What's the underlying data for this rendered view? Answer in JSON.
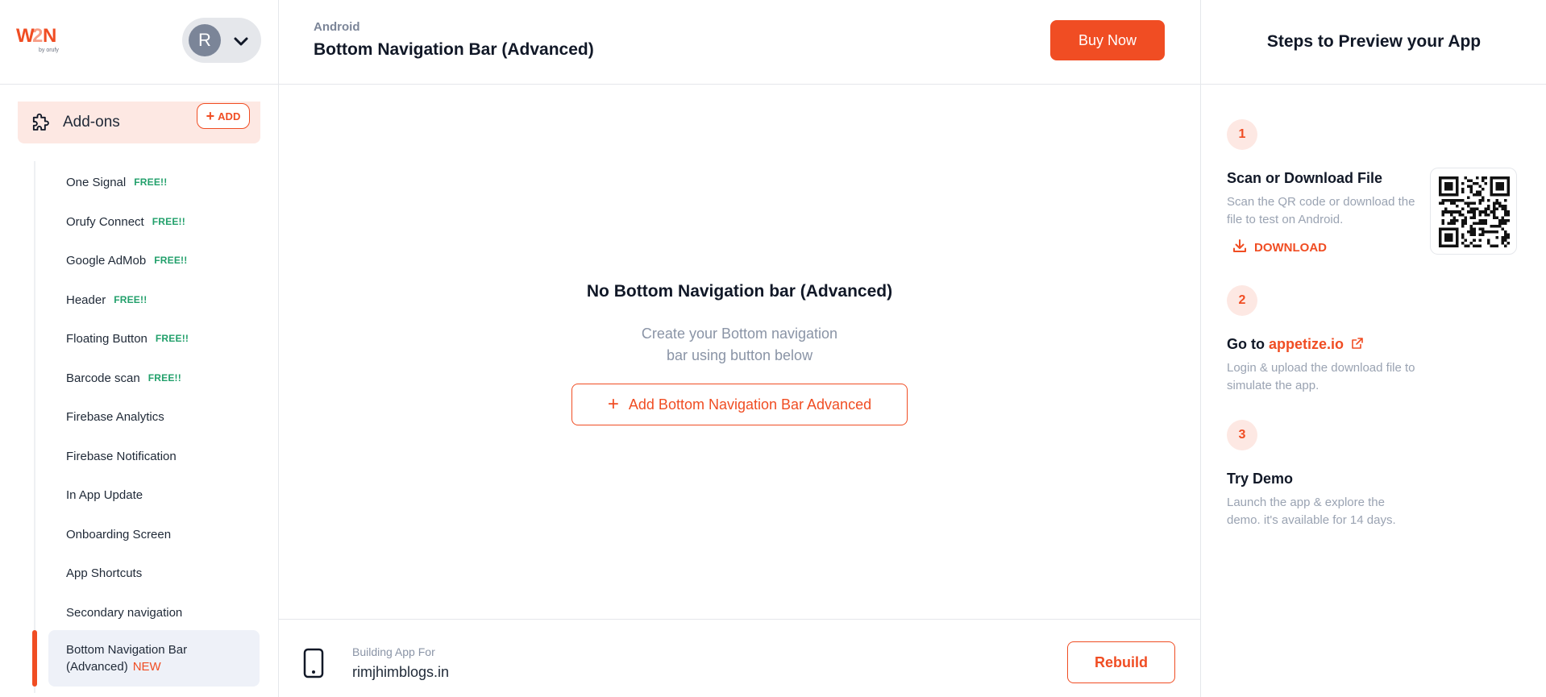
{
  "brand": {
    "logo_text": "W2N",
    "logo_sub": "by orufy",
    "accent": "#f04d23"
  },
  "user": {
    "initial": "R"
  },
  "sidebar": {
    "section_label": "Add-ons",
    "add_label": "ADD",
    "items": [
      {
        "label": "One Signal",
        "badge": "FREE!!"
      },
      {
        "label": "Orufy Connect",
        "badge": "FREE!!"
      },
      {
        "label": "Google AdMob",
        "badge": "FREE!!"
      },
      {
        "label": "Header",
        "badge": "FREE!!"
      },
      {
        "label": "Floating Button",
        "badge": "FREE!!"
      },
      {
        "label": "Barcode scan",
        "badge": "FREE!!"
      },
      {
        "label": "Firebase Analytics",
        "badge": ""
      },
      {
        "label": "Firebase Notification",
        "badge": ""
      },
      {
        "label": "In App Update",
        "badge": ""
      },
      {
        "label": "Onboarding Screen",
        "badge": ""
      },
      {
        "label": "App Shortcuts",
        "badge": ""
      },
      {
        "label": "Secondary navigation",
        "badge": ""
      }
    ],
    "active_item": {
      "label_line1": "Bottom Navigation Bar",
      "label_line2": "(Advanced)",
      "badge": "NEW"
    }
  },
  "header": {
    "platform": "Android",
    "title": "Bottom Navigation Bar (Advanced)",
    "buy_label": "Buy Now"
  },
  "main": {
    "empty_title": "No Bottom Navigation bar (Advanced)",
    "empty_sub_line1": "Create your Bottom navigation",
    "empty_sub_line2": "bar using button below",
    "add_button_label": "Add Bottom Navigation Bar Advanced"
  },
  "footer": {
    "building_label": "Building App For",
    "domain": "rimjhimblogs.in",
    "rebuild_label": "Rebuild"
  },
  "preview": {
    "title": "Steps to Preview your App",
    "steps": [
      {
        "num": "1",
        "title": "Scan or Download File",
        "desc": "Scan the QR code or download the file to test on Android.",
        "action": "DOWNLOAD"
      },
      {
        "num": "2",
        "title_prefix": "Go to",
        "link": "appetize.io",
        "desc": "Login & upload the download file to simulate the app."
      },
      {
        "num": "3",
        "title": "Try Demo",
        "desc": "Launch the app & explore the demo. it's available for 14 days."
      }
    ]
  }
}
